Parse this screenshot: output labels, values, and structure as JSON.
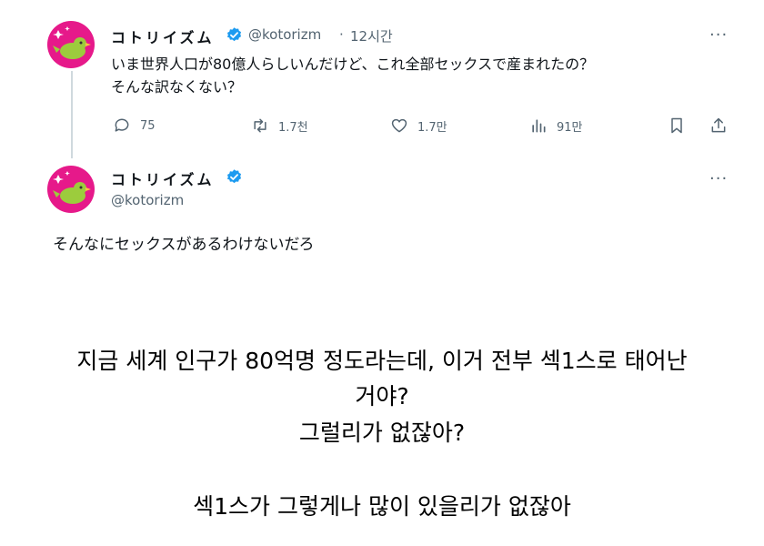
{
  "tweet1": {
    "name": "コトリイズム",
    "handle": "@kotorizm",
    "dot": "·",
    "time": "12시간",
    "more": "···",
    "line1": "いま世界人口が80億人らしいんだけど、これ全部セックスで産まれたの？",
    "line2": "そんな訳なくない？",
    "actions": {
      "reply": "75",
      "retweet": "1.7천",
      "like": "1.7만",
      "views": "91만"
    }
  },
  "tweet2": {
    "name": "コトリイズム",
    "handle": "@kotorizm",
    "more": "···",
    "text": "そんなにセックスがあるわけないだろ"
  },
  "caption": {
    "line1": "지금 세계 인구가 80억명 정도라는데, 이거 전부 섹1스로 태어난",
    "line2": "거야?",
    "line3": "그럴리가 없잖아?",
    "line4": "섹1스가 그렇게나 많이 있을리가 없잖아"
  },
  "colors": {
    "avatar_bg": "#e6198a",
    "bird": "#9ccc3d",
    "verified": "#1d9bf0",
    "muted": "#536471"
  }
}
